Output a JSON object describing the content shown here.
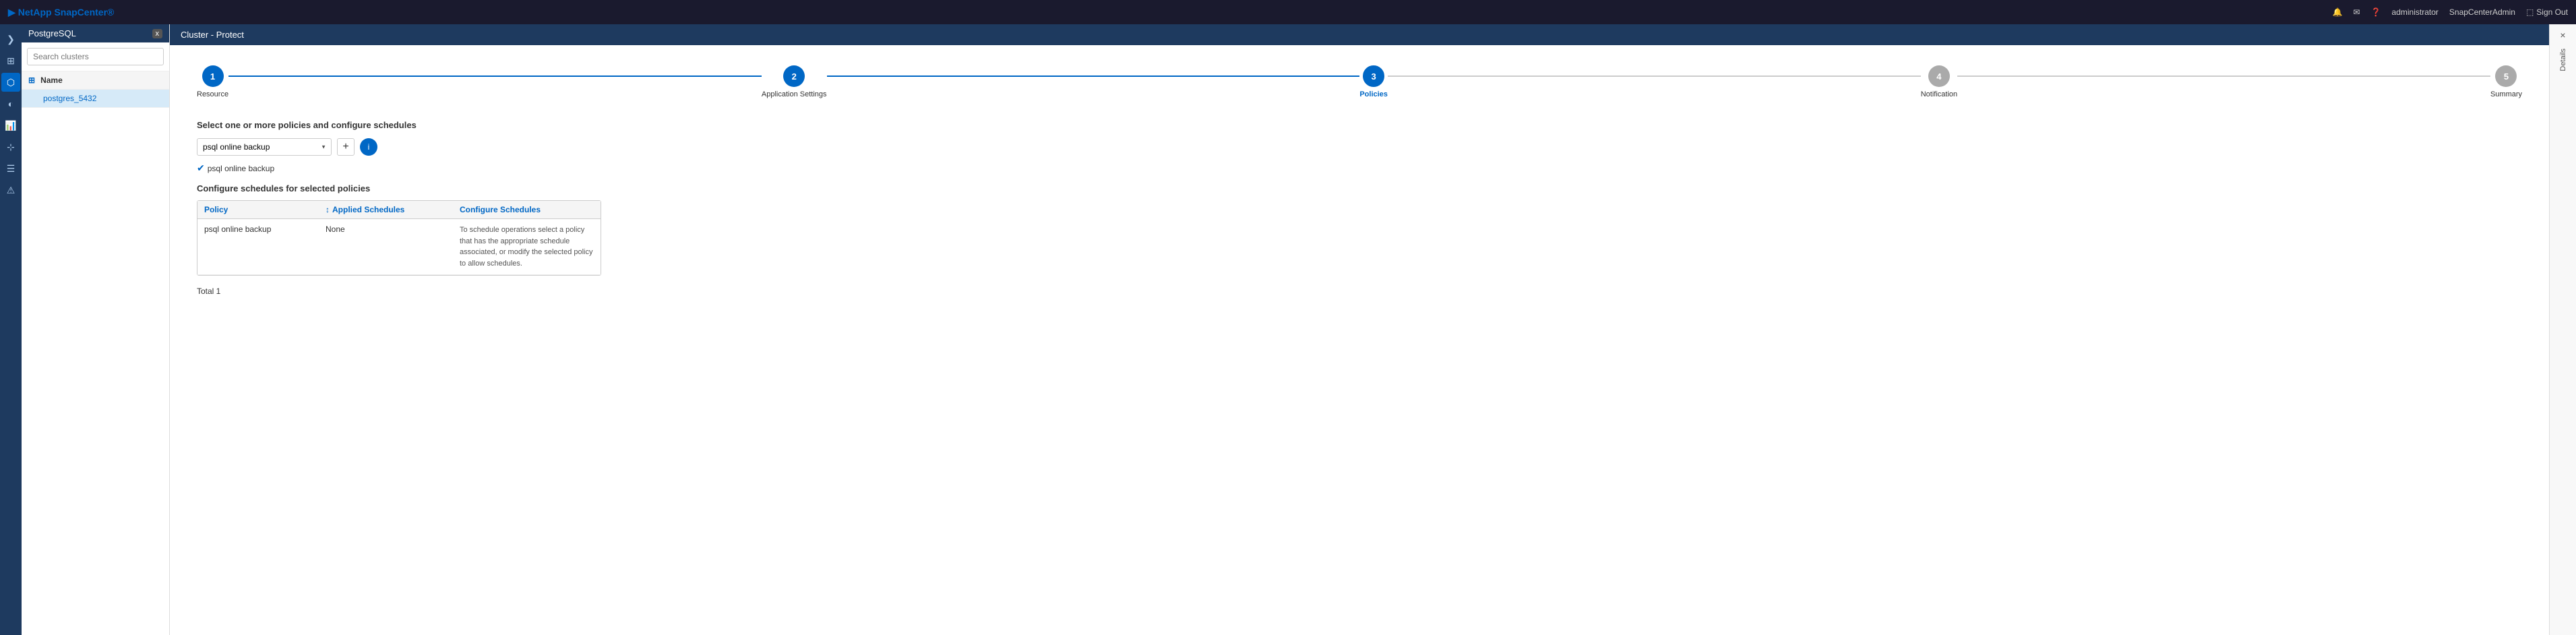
{
  "topNav": {
    "logo": "NetApp SnapCenter®",
    "logoSymbol": "▶",
    "icons": [
      "🔔",
      "✉",
      "?"
    ],
    "user": "administrator",
    "adminUser": "SnapCenterAdmin",
    "signOut": "Sign Out"
  },
  "sidebar": {
    "dbLabel": "PostgreSQL",
    "dbBadge": "x",
    "searchPlaceholder": "Search clusters",
    "listHeader": "Name",
    "items": [
      {
        "label": "postgres_5432",
        "active": true
      }
    ]
  },
  "breadcrumb": "Cluster - Protect",
  "wizard": {
    "steps": [
      {
        "number": "1",
        "label": "Resource",
        "state": "completed"
      },
      {
        "number": "2",
        "label": "Application Settings",
        "state": "completed"
      },
      {
        "number": "3",
        "label": "Policies",
        "state": "active"
      },
      {
        "number": "4",
        "label": "Notification",
        "state": "inactive"
      },
      {
        "number": "5",
        "label": "Summary",
        "state": "inactive"
      }
    ]
  },
  "policies": {
    "selectTitle": "Select one or more policies and configure schedules",
    "dropdownValue": "psql online backup",
    "dropdownOptions": [
      "psql online backup"
    ],
    "addButton": "+",
    "infoButton": "i",
    "selectedPolicy": "psql online backup",
    "configureTitle": "Configure schedules for selected policies",
    "tableHeaders": {
      "policy": "Policy",
      "appliedSchedules": "Applied Schedules",
      "configureSchedules": "Configure Schedules"
    },
    "tableRows": [
      {
        "policy": "psql online backup",
        "appliedSchedules": "None",
        "configureSchedules": "To schedule operations select a policy that has the appropriate schedule associated, or modify the selected policy to allow schedules."
      }
    ],
    "total": "Total 1"
  },
  "rightPanel": {
    "closeLabel": "×",
    "detailsLabel": "Details"
  }
}
